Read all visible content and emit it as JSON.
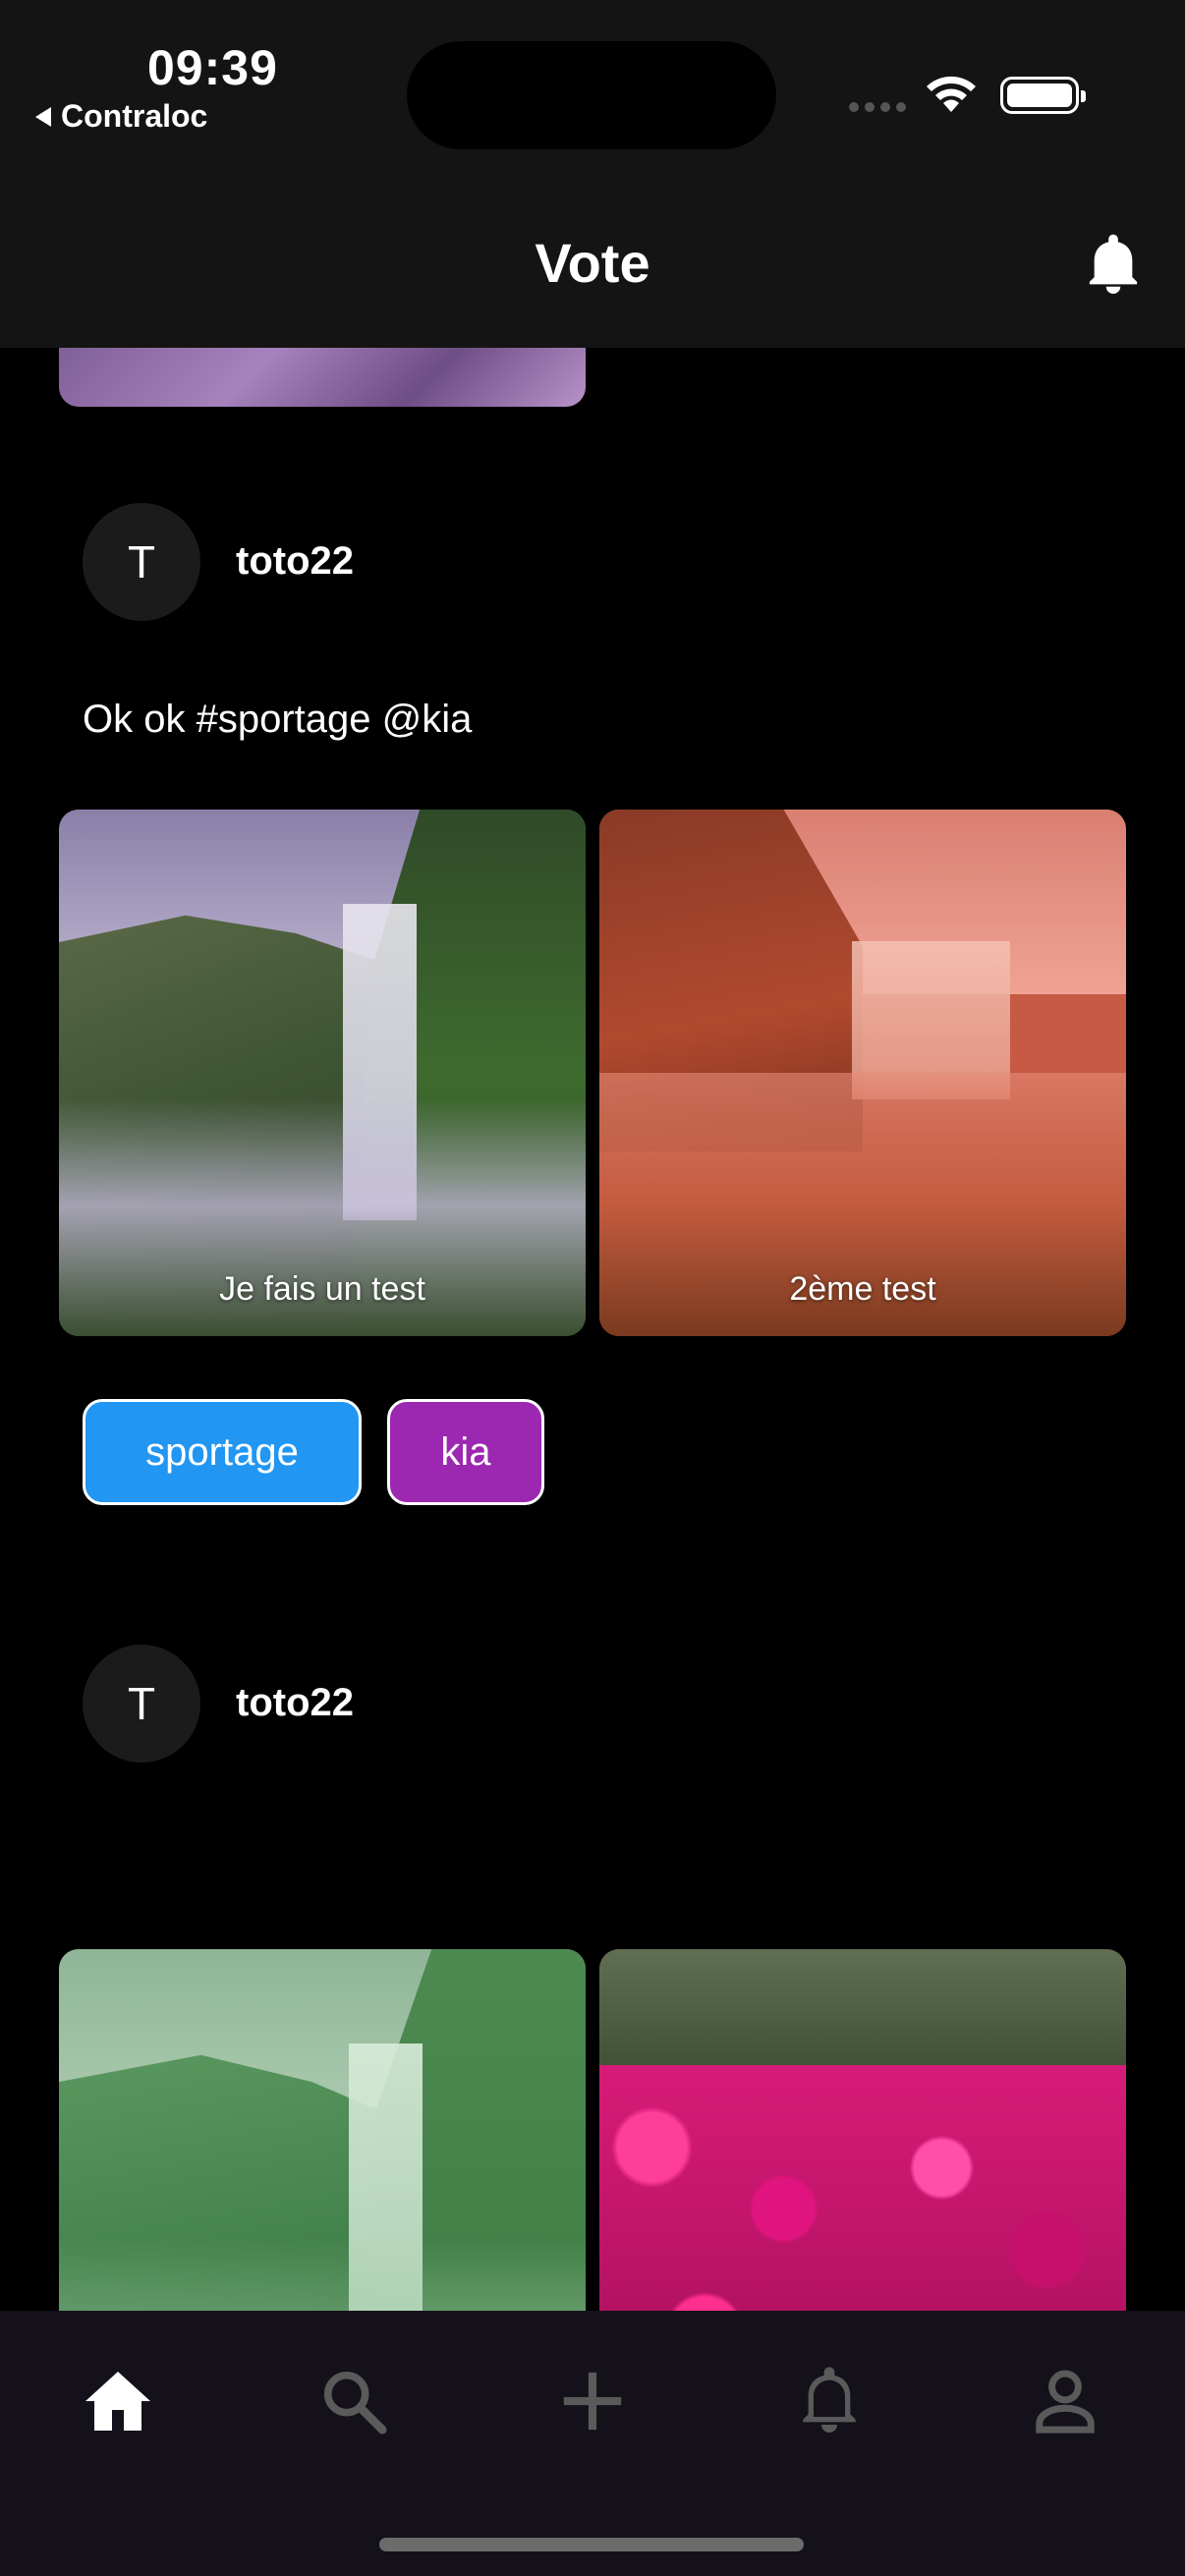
{
  "status_bar": {
    "time": "09:39",
    "back_app": "Contraloc",
    "wifi_icon": "wifi-icon",
    "battery_icon": "battery-icon"
  },
  "header": {
    "title": "Vote",
    "bell_icon": "bell-icon"
  },
  "posts": [
    {
      "avatar_letter": "T",
      "username": "toto22",
      "text": "Ok ok #sportage @kia",
      "images": [
        {
          "caption": "Je fais un test",
          "tint": "#a08ab8"
        },
        {
          "caption": "2ème test",
          "tint": "#d9604c"
        }
      ],
      "tags": [
        {
          "label": "sportage",
          "color": "#2196f3"
        },
        {
          "label": "kia",
          "color": "#9c27b0"
        }
      ]
    },
    {
      "avatar_letter": "T",
      "username": "toto22",
      "text": "",
      "images": [
        {
          "caption": "",
          "tint": "#6fbf7d"
        },
        {
          "caption": "",
          "tint": "#d81b78"
        }
      ]
    }
  ],
  "bottom_nav": {
    "items": [
      {
        "icon": "home-icon",
        "active": true
      },
      {
        "icon": "search-icon",
        "active": false
      },
      {
        "icon": "add-icon",
        "active": false
      },
      {
        "icon": "bell-icon",
        "active": false
      },
      {
        "icon": "profile-icon",
        "active": false
      }
    ]
  }
}
